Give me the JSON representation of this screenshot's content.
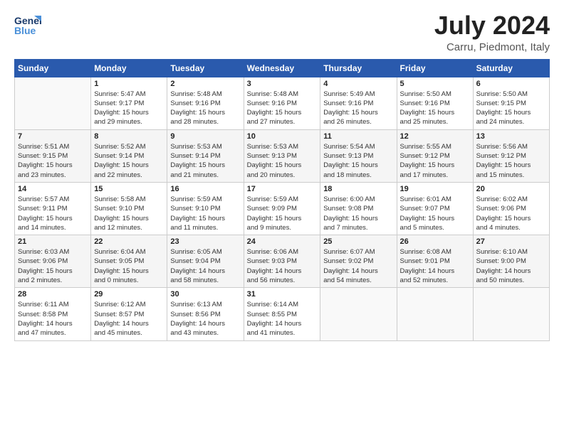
{
  "logo": {
    "line1": "General",
    "line2": "Blue"
  },
  "title": "July 2024",
  "location": "Carru, Piedmont, Italy",
  "days_of_week": [
    "Sunday",
    "Monday",
    "Tuesday",
    "Wednesday",
    "Thursday",
    "Friday",
    "Saturday"
  ],
  "weeks": [
    [
      {
        "day": "",
        "info": ""
      },
      {
        "day": "1",
        "info": "Sunrise: 5:47 AM\nSunset: 9:17 PM\nDaylight: 15 hours\nand 29 minutes."
      },
      {
        "day": "2",
        "info": "Sunrise: 5:48 AM\nSunset: 9:16 PM\nDaylight: 15 hours\nand 28 minutes."
      },
      {
        "day": "3",
        "info": "Sunrise: 5:48 AM\nSunset: 9:16 PM\nDaylight: 15 hours\nand 27 minutes."
      },
      {
        "day": "4",
        "info": "Sunrise: 5:49 AM\nSunset: 9:16 PM\nDaylight: 15 hours\nand 26 minutes."
      },
      {
        "day": "5",
        "info": "Sunrise: 5:50 AM\nSunset: 9:16 PM\nDaylight: 15 hours\nand 25 minutes."
      },
      {
        "day": "6",
        "info": "Sunrise: 5:50 AM\nSunset: 9:15 PM\nDaylight: 15 hours\nand 24 minutes."
      }
    ],
    [
      {
        "day": "7",
        "info": "Sunrise: 5:51 AM\nSunset: 9:15 PM\nDaylight: 15 hours\nand 23 minutes."
      },
      {
        "day": "8",
        "info": "Sunrise: 5:52 AM\nSunset: 9:14 PM\nDaylight: 15 hours\nand 22 minutes."
      },
      {
        "day": "9",
        "info": "Sunrise: 5:53 AM\nSunset: 9:14 PM\nDaylight: 15 hours\nand 21 minutes."
      },
      {
        "day": "10",
        "info": "Sunrise: 5:53 AM\nSunset: 9:13 PM\nDaylight: 15 hours\nand 20 minutes."
      },
      {
        "day": "11",
        "info": "Sunrise: 5:54 AM\nSunset: 9:13 PM\nDaylight: 15 hours\nand 18 minutes."
      },
      {
        "day": "12",
        "info": "Sunrise: 5:55 AM\nSunset: 9:12 PM\nDaylight: 15 hours\nand 17 minutes."
      },
      {
        "day": "13",
        "info": "Sunrise: 5:56 AM\nSunset: 9:12 PM\nDaylight: 15 hours\nand 15 minutes."
      }
    ],
    [
      {
        "day": "14",
        "info": "Sunrise: 5:57 AM\nSunset: 9:11 PM\nDaylight: 15 hours\nand 14 minutes."
      },
      {
        "day": "15",
        "info": "Sunrise: 5:58 AM\nSunset: 9:10 PM\nDaylight: 15 hours\nand 12 minutes."
      },
      {
        "day": "16",
        "info": "Sunrise: 5:59 AM\nSunset: 9:10 PM\nDaylight: 15 hours\nand 11 minutes."
      },
      {
        "day": "17",
        "info": "Sunrise: 5:59 AM\nSunset: 9:09 PM\nDaylight: 15 hours\nand 9 minutes."
      },
      {
        "day": "18",
        "info": "Sunrise: 6:00 AM\nSunset: 9:08 PM\nDaylight: 15 hours\nand 7 minutes."
      },
      {
        "day": "19",
        "info": "Sunrise: 6:01 AM\nSunset: 9:07 PM\nDaylight: 15 hours\nand 5 minutes."
      },
      {
        "day": "20",
        "info": "Sunrise: 6:02 AM\nSunset: 9:06 PM\nDaylight: 15 hours\nand 4 minutes."
      }
    ],
    [
      {
        "day": "21",
        "info": "Sunrise: 6:03 AM\nSunset: 9:06 PM\nDaylight: 15 hours\nand 2 minutes."
      },
      {
        "day": "22",
        "info": "Sunrise: 6:04 AM\nSunset: 9:05 PM\nDaylight: 15 hours\nand 0 minutes."
      },
      {
        "day": "23",
        "info": "Sunrise: 6:05 AM\nSunset: 9:04 PM\nDaylight: 14 hours\nand 58 minutes."
      },
      {
        "day": "24",
        "info": "Sunrise: 6:06 AM\nSunset: 9:03 PM\nDaylight: 14 hours\nand 56 minutes."
      },
      {
        "day": "25",
        "info": "Sunrise: 6:07 AM\nSunset: 9:02 PM\nDaylight: 14 hours\nand 54 minutes."
      },
      {
        "day": "26",
        "info": "Sunrise: 6:08 AM\nSunset: 9:01 PM\nDaylight: 14 hours\nand 52 minutes."
      },
      {
        "day": "27",
        "info": "Sunrise: 6:10 AM\nSunset: 9:00 PM\nDaylight: 14 hours\nand 50 minutes."
      }
    ],
    [
      {
        "day": "28",
        "info": "Sunrise: 6:11 AM\nSunset: 8:58 PM\nDaylight: 14 hours\nand 47 minutes."
      },
      {
        "day": "29",
        "info": "Sunrise: 6:12 AM\nSunset: 8:57 PM\nDaylight: 14 hours\nand 45 minutes."
      },
      {
        "day": "30",
        "info": "Sunrise: 6:13 AM\nSunset: 8:56 PM\nDaylight: 14 hours\nand 43 minutes."
      },
      {
        "day": "31",
        "info": "Sunrise: 6:14 AM\nSunset: 8:55 PM\nDaylight: 14 hours\nand 41 minutes."
      },
      {
        "day": "",
        "info": ""
      },
      {
        "day": "",
        "info": ""
      },
      {
        "day": "",
        "info": ""
      }
    ]
  ]
}
